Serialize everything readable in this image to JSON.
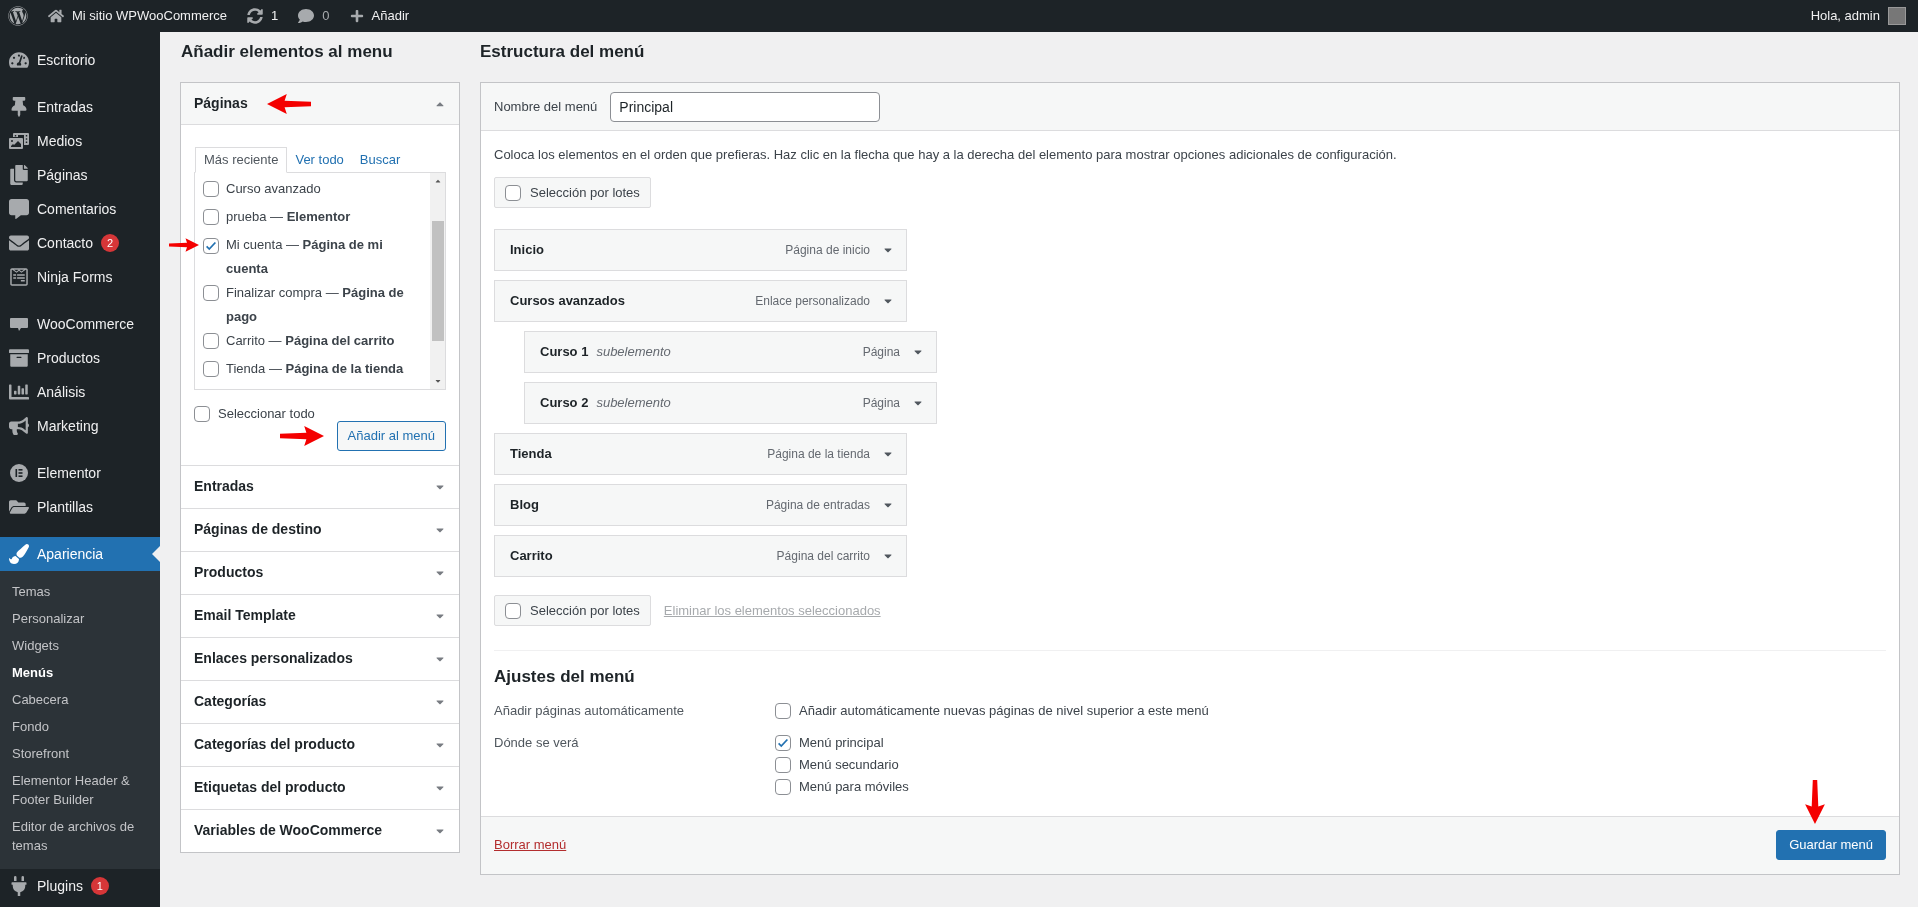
{
  "admin_bar": {
    "site": "Mi sitio WPWooCommerce",
    "updates": "1",
    "comments": "0",
    "new": "Añadir",
    "greeting": "Hola, admin"
  },
  "sidebar": {
    "groups": [
      {
        "items": [
          {
            "label": "Escritorio",
            "selected": false
          }
        ]
      },
      {
        "items": [
          {
            "label": "Entradas",
            "selected": false
          },
          {
            "label": "Medios",
            "selected": false
          },
          {
            "label": "Páginas",
            "selected": false
          },
          {
            "label": "Comentarios",
            "selected": false
          },
          {
            "label": "Contacto",
            "badge": "2",
            "selected": false
          },
          {
            "label": "Ninja Forms",
            "selected": false
          }
        ]
      },
      {
        "items": [
          {
            "label": "WooCommerce",
            "selected": false
          },
          {
            "label": "Productos",
            "selected": false
          },
          {
            "label": "Análisis",
            "selected": false
          },
          {
            "label": "Marketing",
            "selected": false
          }
        ]
      },
      {
        "items": [
          {
            "label": "Elementor",
            "selected": false
          },
          {
            "label": "Plantillas",
            "selected": false
          }
        ]
      },
      {
        "items": [
          {
            "label": "Apariencia",
            "selected": true,
            "children": [
              {
                "label": "Temas",
                "selected": false
              },
              {
                "label": "Personalizar",
                "selected": false
              },
              {
                "label": "Widgets",
                "selected": false
              },
              {
                "label": "Menús",
                "selected": true
              },
              {
                "label": "Cabecera",
                "selected": false
              },
              {
                "label": "Fondo",
                "selected": false
              },
              {
                "label": "Storefront",
                "selected": false
              },
              {
                "label": "Elementor Header & Footer Builder",
                "selected": false
              },
              {
                "label": "Editor de archivos de temas",
                "selected": false
              }
            ]
          },
          {
            "label": "Plugins",
            "badge": "1",
            "selected": false
          }
        ]
      }
    ]
  },
  "add_items": {
    "title": "Añadir elementos al menu",
    "sections": [
      {
        "title": "Páginas",
        "expanded": true,
        "tabs": [
          {
            "label": "Más reciente",
            "selected": true
          },
          {
            "label": "Ver todo",
            "selected": false
          },
          {
            "label": "Buscar",
            "selected": false
          }
        ],
        "items": [
          {
            "label": "Curso avanzado",
            "checked": false
          },
          {
            "label": "prueba — **Elementor**",
            "checked": false
          },
          {
            "label": "Mi cuenta — **Página de mi cuenta**",
            "checked": true
          },
          {
            "label": "Finalizar compra — **Página de pago**",
            "checked": false
          },
          {
            "label": "Carrito — **Página del carrito**",
            "checked": false
          },
          {
            "label": "Tienda — **Página de la tienda**",
            "checked": false
          }
        ],
        "select_all": {
          "label": "Seleccionar todo",
          "checked": false
        },
        "button": "Añadir al menú"
      },
      {
        "title": "Entradas",
        "expanded": false
      },
      {
        "title": "Páginas de destino",
        "expanded": false
      },
      {
        "title": "Productos",
        "expanded": false
      },
      {
        "title": "Email Template",
        "expanded": false
      },
      {
        "title": "Enlaces personalizados",
        "expanded": false
      },
      {
        "title": "Categorías",
        "expanded": false
      },
      {
        "title": "Categorías del producto",
        "expanded": false
      },
      {
        "title": "Etiquetas del producto",
        "expanded": false
      },
      {
        "title": "Variables de WooCommerce",
        "expanded": false
      }
    ]
  },
  "structure": {
    "title": "Estructura del menú",
    "name_label": "Nombre del menú",
    "name_value": "Principal",
    "instructions": "Coloca los elementos en el orden que prefieras. Haz clic en la flecha que hay a la derecha del elemento para mostrar opciones adicionales de configuración.",
    "bulk_top": {
      "label": "Selección por lotes",
      "checked": false
    },
    "menu_items": [
      {
        "title": "Inicio",
        "type": "Página de inicio"
      },
      {
        "title": "Cursos avanzados",
        "type": "Enlace personalizado",
        "children": [
          {
            "title": "Curso 1",
            "note": "subelemento",
            "type": "Página"
          },
          {
            "title": "Curso 2",
            "note": "subelemento",
            "type": "Página"
          }
        ]
      },
      {
        "title": "Tienda",
        "type": "Página de la tienda"
      },
      {
        "title": "Blog",
        "type": "Página de entradas"
      },
      {
        "title": "Carrito",
        "type": "Página del carrito"
      }
    ],
    "bulk_bottom": {
      "label": "Selección por lotes",
      "checked": false
    },
    "remove_link": {
      "label": "Eliminar los elementos seleccionados",
      "disabled": true
    },
    "settings": {
      "title": "Ajustes del menú",
      "rows": [
        {
          "label": "Añadir páginas automáticamente",
          "options": [
            {
              "label": "Añadir automáticamente nuevas páginas de nivel superior a este menú",
              "checked": false
            }
          ]
        },
        {
          "label": "Dónde se verá",
          "options": [
            {
              "label": "Menú principal",
              "checked": true
            },
            {
              "label": "Menú secundario",
              "checked": false
            },
            {
              "label": "Menú para móviles",
              "checked": false
            }
          ]
        }
      ]
    },
    "delete_link": "Borrar menú",
    "save_button": "Guardar menú"
  }
}
